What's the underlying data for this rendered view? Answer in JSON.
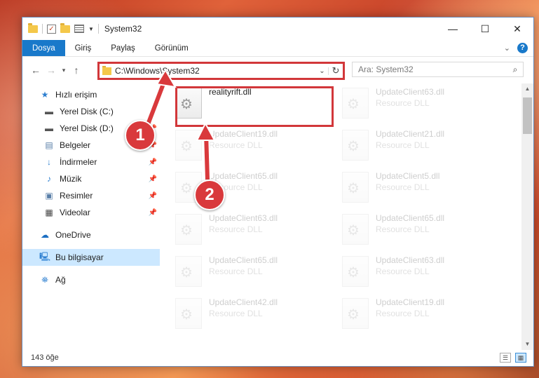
{
  "window": {
    "title": "System32",
    "min_symbol": "—",
    "max_symbol": "☐",
    "close_symbol": "✕"
  },
  "ribbon": {
    "tabs": [
      "Dosya",
      "Giriş",
      "Paylaş",
      "Görünüm"
    ]
  },
  "address": {
    "path": "C:\\Windows\\System32"
  },
  "search": {
    "placeholder": "Ara: System32"
  },
  "sidebar": {
    "items": [
      {
        "label": "Hızlı erişim",
        "icon": "star-icon"
      },
      {
        "label": "Yerel Disk (C:)",
        "icon": "drive-icon"
      },
      {
        "label": "Yerel Disk (D:)",
        "icon": "drive-icon"
      },
      {
        "label": "Belgeler",
        "icon": "documents-icon"
      },
      {
        "label": "İndirmeler",
        "icon": "download-icon"
      },
      {
        "label": "Müzik",
        "icon": "music-icon"
      },
      {
        "label": "Resimler",
        "icon": "pictures-icon"
      },
      {
        "label": "Videolar",
        "icon": "videos-icon"
      },
      {
        "label": "OneDrive",
        "icon": "cloud-icon"
      },
      {
        "label": "Bu bilgisayar",
        "icon": "computer-icon"
      },
      {
        "label": "Ağ",
        "icon": "network-icon"
      }
    ]
  },
  "files": [
    {
      "name": "realityrift.dll",
      "type": ""
    },
    {
      "name": "UpdateClient63.dll",
      "type": "Resource DLL"
    },
    {
      "name": "UpdateClient19.dll",
      "type": "Resource DLL"
    },
    {
      "name": "UpdateClient21.dll",
      "type": "Resource DLL"
    },
    {
      "name": "UpdateClient65.dll",
      "type": "Resource DLL"
    },
    {
      "name": "UpdateClient5.dll",
      "type": "Resource DLL"
    },
    {
      "name": "UpdateClient63.dll",
      "type": "Resource DLL"
    },
    {
      "name": "UpdateClient65.dll",
      "type": "Resource DLL"
    },
    {
      "name": "UpdateClient65.dll",
      "type": "Resource DLL"
    },
    {
      "name": "UpdateClient63.dll",
      "type": "Resource DLL"
    },
    {
      "name": "UpdateClient42.dll",
      "type": "Resource DLL"
    },
    {
      "name": "UpdateClient19.dll",
      "type": "Resource DLL"
    }
  ],
  "status": {
    "count": "143 öğe"
  },
  "annotations": {
    "step1": "1",
    "step2": "2",
    "color": "#d9393c"
  }
}
